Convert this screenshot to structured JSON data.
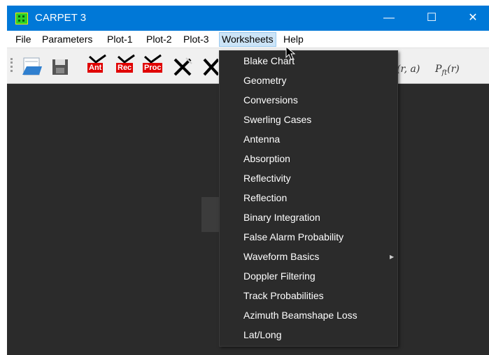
{
  "window": {
    "title": "CARPET 3"
  },
  "controls": {
    "minimize": "—",
    "maximize": "☐",
    "close": "✕"
  },
  "menubar": {
    "items": [
      {
        "label": "File"
      },
      {
        "label": "Parameters"
      },
      {
        "label": "Plot-1"
      },
      {
        "label": "Plot-2"
      },
      {
        "label": "Plot-3"
      },
      {
        "label": "Worksheets"
      },
      {
        "label": "Help"
      }
    ]
  },
  "toolbar": {
    "ant": "Ant",
    "rec": "Rec",
    "proc": "Proc",
    "formula1": "(r, a)",
    "formula2": "P",
    "formula2_sub": "ft",
    "formula2_tail": "(r)"
  },
  "worksheets_menu": {
    "items": [
      {
        "label": "Blake Chart"
      },
      {
        "label": "Geometry"
      },
      {
        "label": "Conversions"
      },
      {
        "label": "Swerling Cases"
      },
      {
        "label": "Antenna"
      },
      {
        "label": "Absorption"
      },
      {
        "label": "Reflectivity"
      },
      {
        "label": "Reflection"
      },
      {
        "label": "Binary Integration"
      },
      {
        "label": "False Alarm Probability"
      },
      {
        "label": "Waveform Basics",
        "submenu": true
      },
      {
        "label": "Doppler Filtering"
      },
      {
        "label": "Track Probabilities"
      },
      {
        "label": "Azimuth Beamshape Loss"
      },
      {
        "label": "Lat/Long"
      }
    ]
  }
}
